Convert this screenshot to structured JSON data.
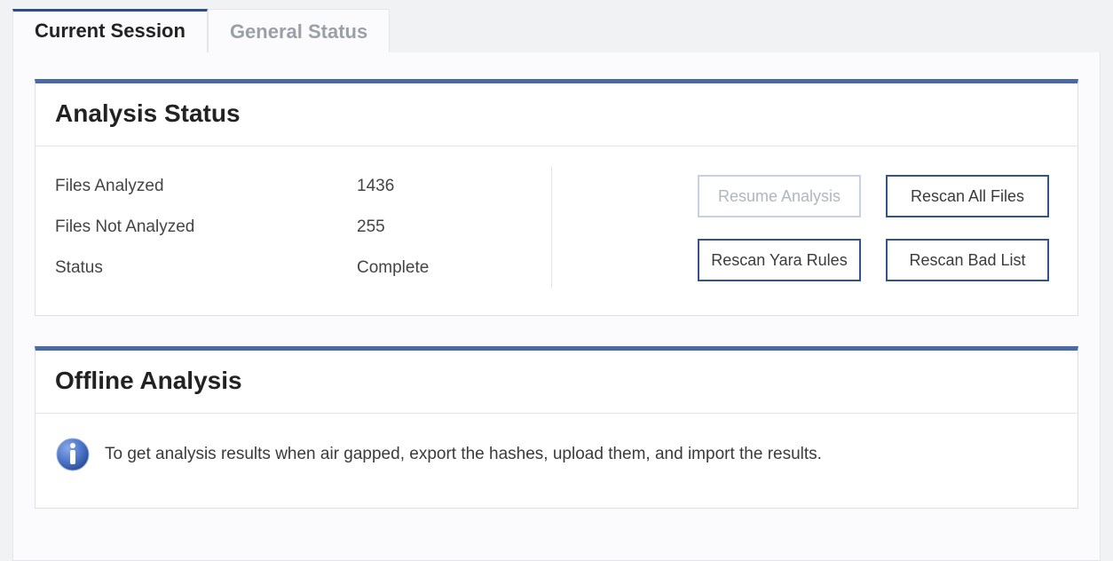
{
  "tabs": {
    "current_session": "Current Session",
    "general_status": "General Status"
  },
  "analysis_status": {
    "title": "Analysis Status",
    "files_analyzed_label": "Files Analyzed",
    "files_analyzed_value": "1436",
    "files_not_analyzed_label": "Files Not Analyzed",
    "files_not_analyzed_value": "255",
    "status_label": "Status",
    "status_value": "Complete",
    "resume_button": "Resume Analysis",
    "rescan_all_button": "Rescan All Files",
    "rescan_yara_button": "Rescan Yara Rules",
    "rescan_bad_button": "Rescan Bad List"
  },
  "offline_analysis": {
    "title": "Offline Analysis",
    "info_text": "To get analysis results when air gapped, export the hashes, upload them, and import the results."
  }
}
